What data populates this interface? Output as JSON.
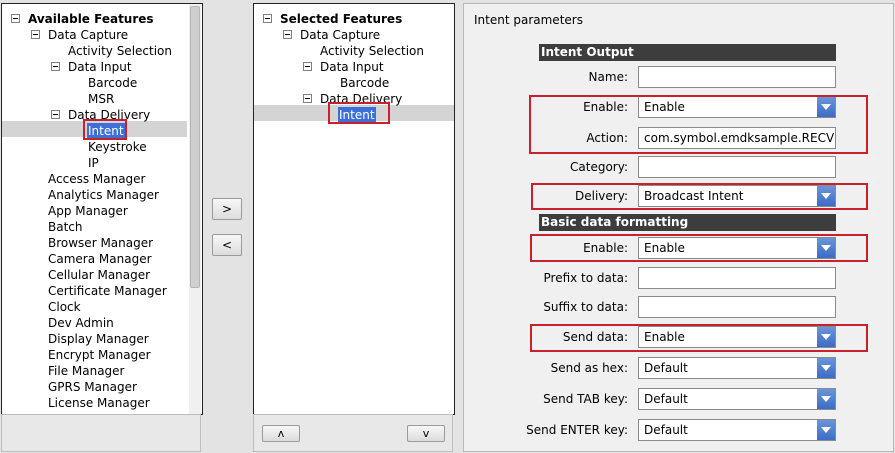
{
  "available": {
    "title": "Available Features",
    "items": [
      {
        "label": "Data Capture",
        "expand": true
      },
      {
        "label": "Activity Selection"
      },
      {
        "label": "Data Input",
        "expand": true
      },
      {
        "label": "Barcode"
      },
      {
        "label": "MSR"
      },
      {
        "label": "Data Delivery",
        "expand": true
      },
      {
        "label": "Intent",
        "selected": true
      },
      {
        "label": "Keystroke"
      },
      {
        "label": "IP"
      },
      {
        "label": "Access Manager"
      },
      {
        "label": "Analytics Manager"
      },
      {
        "label": "App Manager"
      },
      {
        "label": "Batch"
      },
      {
        "label": "Browser Manager"
      },
      {
        "label": "Camera Manager"
      },
      {
        "label": "Cellular Manager"
      },
      {
        "label": "Certificate Manager"
      },
      {
        "label": "Clock"
      },
      {
        "label": "Dev Admin"
      },
      {
        "label": "Display Manager"
      },
      {
        "label": "Encrypt Manager"
      },
      {
        "label": "File Manager"
      },
      {
        "label": "GPRS Manager"
      },
      {
        "label": "License Manager"
      }
    ]
  },
  "selected": {
    "title": "Selected Features",
    "items": [
      {
        "label": "Data Capture",
        "expand": true
      },
      {
        "label": "Activity Selection"
      },
      {
        "label": "Data Input",
        "expand": true
      },
      {
        "label": "Barcode"
      },
      {
        "label": "Data Delivery",
        "expand": true
      },
      {
        "label": "Intent",
        "selected": true
      }
    ]
  },
  "buttons": {
    "add": ">",
    "remove": "<",
    "up": "ʌ",
    "down": "v"
  },
  "params": {
    "title": "Intent parameters",
    "intent_output": "Intent Output",
    "basic_formatting": "Basic data formatting",
    "name_label": "Name:",
    "name_value": "",
    "enable_label": "Enable:",
    "enable_value": "Enable",
    "action_label": "Action:",
    "action_value": "com.symbol.emdksample.RECVRBI",
    "category_label": "Category:",
    "category_value": "",
    "delivery_label": "Delivery:",
    "delivery_value": "Broadcast Intent",
    "bdf_enable_label": "Enable:",
    "bdf_enable_value": "Enable",
    "prefix_label": "Prefix to data:",
    "prefix_value": "",
    "suffix_label": "Suffix to data:",
    "suffix_value": "",
    "send_data_label": "Send data:",
    "send_data_value": "Enable",
    "send_hex_label": "Send as hex:",
    "send_hex_value": "Default",
    "send_tab_label": "Send TAB key:",
    "send_tab_value": "Default",
    "send_enter_label": "Send ENTER key:",
    "send_enter_value": "Default"
  },
  "colors": {
    "highlight": "#c8202c",
    "selection": "#3c6fd8",
    "header_bg": "#3d3d3d"
  }
}
